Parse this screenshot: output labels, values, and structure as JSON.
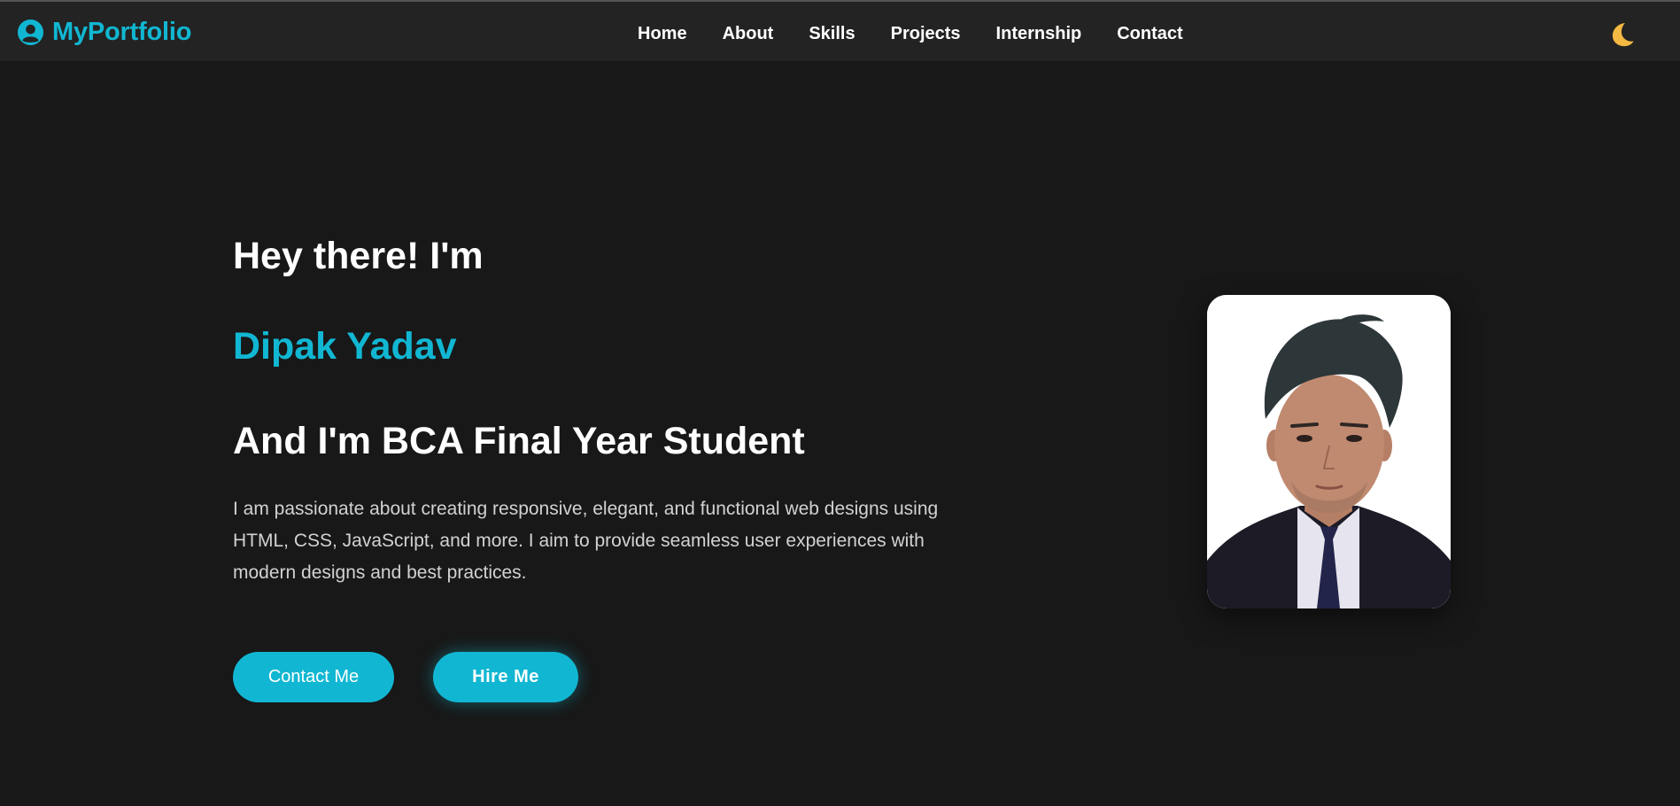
{
  "header": {
    "brand": "MyPortfolio",
    "brand_icon": "user-circle-icon",
    "nav": [
      "Home",
      "About",
      "Skills",
      "Projects",
      "Internship",
      "Contact"
    ],
    "theme_icon": "moon-icon"
  },
  "hero": {
    "greeting": "Hey there! I'm",
    "name": "Dipak Yadav",
    "role": "And I'm BCA Final Year Student",
    "bio": "I am passionate about creating responsive, elegant, and functional web designs using HTML, CSS, JavaScript, and more. I aim to provide seamless user experiences with modern designs and best practices.",
    "contact_button": "Contact Me",
    "hire_button": "Hire Me"
  },
  "colors": {
    "accent": "#11b7d2",
    "background": "#181818",
    "header": "#232323",
    "moon": "#f4b942"
  }
}
